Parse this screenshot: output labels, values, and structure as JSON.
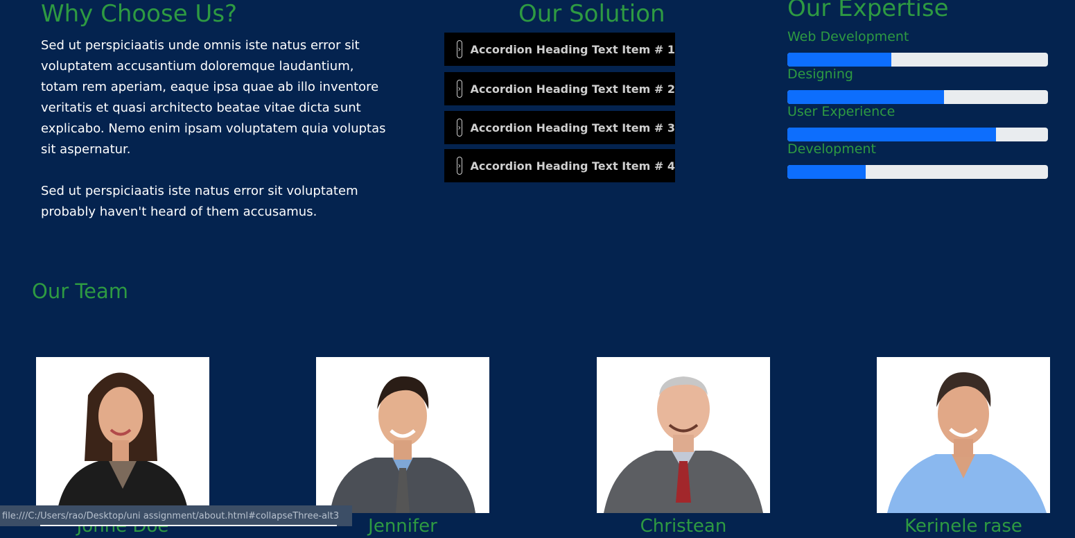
{
  "why": {
    "title": "Why Choose Us?",
    "paragraph1": "Sed ut perspiciaatis unde omnis iste natus error sit voluptatem accusantium doloremque laudantium, totam rem aperiam, eaque ipsa quae ab illo inventore veritatis et quasi architecto beatae vitae dicta sunt explicabo. Nemo enim ipsam voluptatem quia voluptas sit aspernatur.",
    "paragraph2": "Sed ut perspiciaatis iste natus error sit voluptatem probably haven't heard of them accusamus."
  },
  "solution": {
    "title": "Our Solution",
    "items": [
      {
        "label": "Accordion Heading Text Item # 1",
        "icon": "chevron-right-icon"
      },
      {
        "label": "Accordion Heading Text Item # 2",
        "icon": "chevron-right-icon"
      },
      {
        "label": "Accordion Heading Text Item # 3",
        "icon": "chevron-right-icon"
      },
      {
        "label": "Accordion Heading Text Item # 4",
        "icon": "chevron-right-icon"
      }
    ]
  },
  "expertise": {
    "title": "Our Expertise",
    "skills": [
      {
        "label": "Web Development",
        "percent": 40
      },
      {
        "label": "Designing",
        "percent": 60
      },
      {
        "label": "User Experience",
        "percent": 80
      },
      {
        "label": "Development",
        "percent": 30
      }
    ]
  },
  "team": {
    "title": "Our Team",
    "members": [
      {
        "name": "Johne Doe"
      },
      {
        "name": "Jennifer"
      },
      {
        "name": "Christean"
      },
      {
        "name": "Kerinele rase"
      }
    ]
  },
  "status_bar": {
    "url": "file:///C:/Users/rao/Desktop/uni assignment/about.html#collapseThree-alt3"
  },
  "colors": {
    "background": "#04234f",
    "heading": "#2e9a42",
    "progress": "#0d6efd",
    "accordion": "#000000"
  }
}
